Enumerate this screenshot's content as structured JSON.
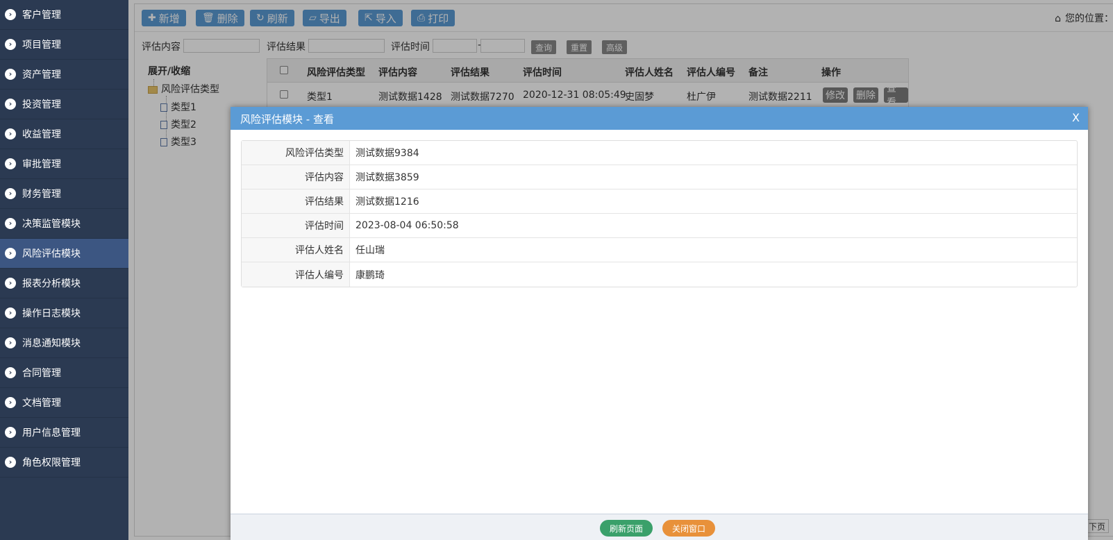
{
  "sidebar": {
    "items": [
      {
        "label": "客户管理"
      },
      {
        "label": "项目管理"
      },
      {
        "label": "资产管理"
      },
      {
        "label": "投资管理"
      },
      {
        "label": "收益管理"
      },
      {
        "label": "审批管理"
      },
      {
        "label": "财务管理"
      },
      {
        "label": "决策监管模块"
      },
      {
        "label": "风险评估模块"
      },
      {
        "label": "报表分析模块"
      },
      {
        "label": "操作日志模块"
      },
      {
        "label": "消息通知模块"
      },
      {
        "label": "合同管理"
      },
      {
        "label": "文档管理"
      },
      {
        "label": "用户信息管理"
      },
      {
        "label": "角色权限管理"
      }
    ],
    "active_index": 8
  },
  "toolbar": {
    "add": "新增",
    "delete": "删除",
    "refresh": "刷新",
    "export": "导出",
    "import": "导入",
    "print": "打印",
    "location_label": "您的位置：主页"
  },
  "search": {
    "content_label": "评估内容",
    "result_label": "评估结果",
    "time_label": "评估时间",
    "range_sep": "-",
    "query": "查询",
    "reset": "重置",
    "advanced": "高级"
  },
  "tree": {
    "root": "展开/收缩",
    "folder": "风险评估类型",
    "leaves": [
      "类型1",
      "类型2",
      "类型3"
    ]
  },
  "table": {
    "headers": [
      "风险评估类型",
      "评估内容",
      "评估结果",
      "评估时间",
      "评估人姓名",
      "评估人编号",
      "备注",
      "操作"
    ],
    "rows": [
      {
        "type": "类型1",
        "content": "测试数据1428",
        "result": "测试数据7270",
        "time": "2020-12-31 08:05:49",
        "name": "史固梦",
        "code": "杜广伊",
        "note": "测试数据2211",
        "actions": {
          "edit": "修改",
          "delete": "删除",
          "view": "查看"
        }
      }
    ]
  },
  "pager": {
    "next": "下页"
  },
  "modal": {
    "title": "风险评估模块 - 查看",
    "close": "X",
    "fields": [
      {
        "label": "风险评估类型",
        "value": "测试数据9384"
      },
      {
        "label": "评估内容",
        "value": "测试数据3859"
      },
      {
        "label": "评估结果",
        "value": "测试数据1216"
      },
      {
        "label": "评估时间",
        "value": "2023-08-04 06:50:58"
      },
      {
        "label": "评估人姓名",
        "value": "任山瑞"
      },
      {
        "label": "评估人编号",
        "value": "康鹏琦"
      }
    ],
    "refresh": "刷新页面",
    "close_window": "关闭窗口"
  },
  "colors": {
    "sidebar_bg": "#2b3a52",
    "sidebar_active": "#3c5682",
    "accent_blue": "#5b9bd5",
    "green_button": "#3aa06a",
    "orange_button": "#e8913a"
  }
}
